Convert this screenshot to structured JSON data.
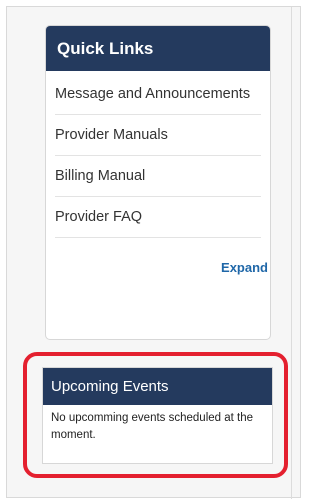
{
  "quick_links": {
    "title": "Quick Links",
    "items": [
      {
        "label": "Message and Announcements"
      },
      {
        "label": "Provider Manuals"
      },
      {
        "label": "Billing Manual"
      },
      {
        "label": "Provider FAQ"
      }
    ],
    "expand_label": "Expand"
  },
  "upcoming_events": {
    "title": "Upcoming Events",
    "message": "No upcomming events scheduled at the moment."
  },
  "colors": {
    "header_bg": "#243a5e",
    "link_accent": "#1f67a8",
    "highlight": "#e4202f"
  }
}
